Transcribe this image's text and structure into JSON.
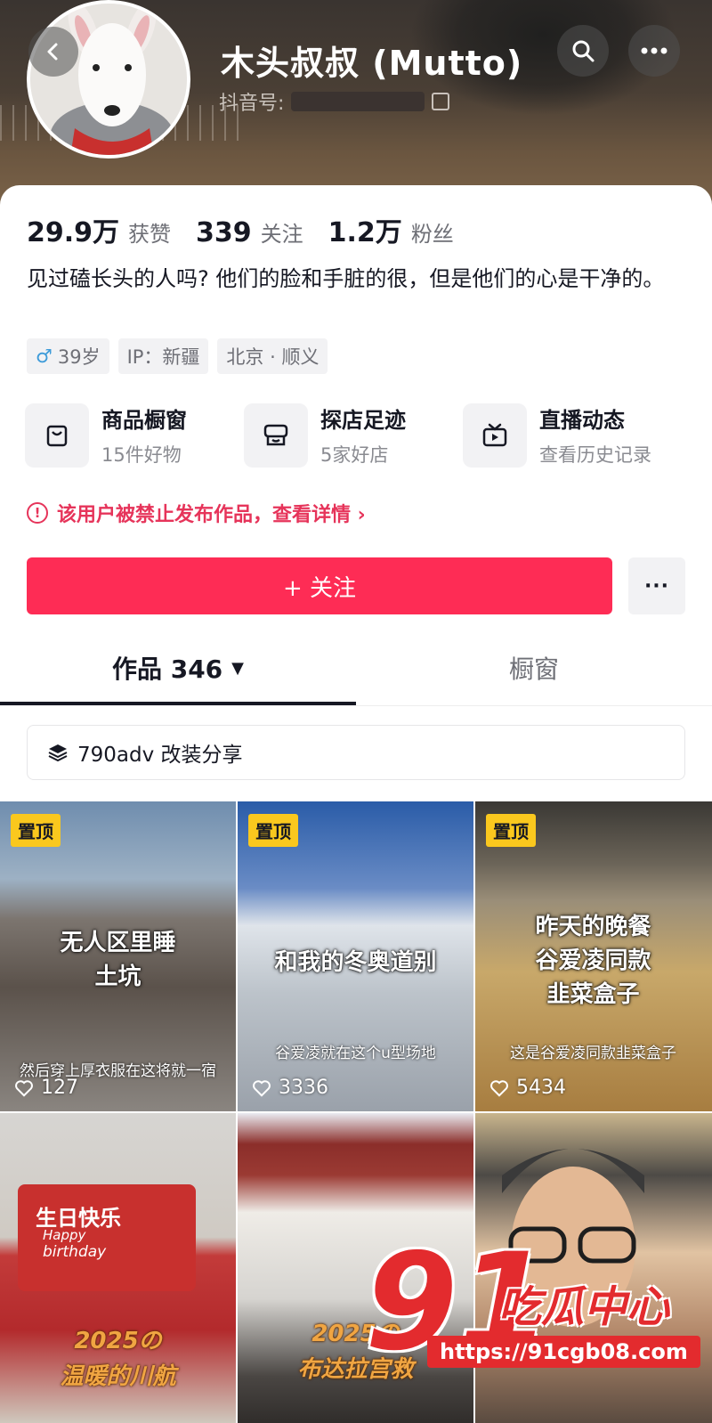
{
  "header": {
    "name": "木头叔叔 (Mutto)",
    "douyin_id_label": "抖音号:",
    "back_icon": "chevron-left-icon",
    "search_icon": "search-icon",
    "more_icon": "ellipsis-icon"
  },
  "stats": [
    {
      "value": "29.9万",
      "label": "获赞"
    },
    {
      "value": "339",
      "label": "关注"
    },
    {
      "value": "1.2万",
      "label": "粉丝"
    }
  ],
  "bio": "见过磕长头的人吗? 他们的脸和手脏的很，但是他们的心是干净的。",
  "tags": {
    "gender_symbol": "♂",
    "age": "39岁",
    "ip": "IP：新疆",
    "location": "北京 · 顺义"
  },
  "features": [
    {
      "title": "商品橱窗",
      "sub": "15件好物",
      "icon": "shopping-bag-icon"
    },
    {
      "title": "探店足迹",
      "sub": "5家好店",
      "icon": "store-icon"
    },
    {
      "title": "直播动态",
      "sub": "查看历史记录",
      "icon": "tv-icon"
    }
  ],
  "banned_notice": "该用户被禁止发布作品，查看详情 ›",
  "follow_button": "+ 关注",
  "follow_more": "···",
  "tabs": {
    "works": "作品 346",
    "shop": "橱窗"
  },
  "collection": "790adv 改装分享",
  "videos": [
    {
      "pinned": "置顶",
      "overlay": "无人区里睡\n土坑",
      "caption": "然后穿上厚衣服在这将就一宿",
      "likes": "127"
    },
    {
      "pinned": "置顶",
      "overlay": "和我的冬奥道别",
      "caption": "谷爱凌就在这个u型场地",
      "likes": "3336"
    },
    {
      "pinned": "置顶",
      "overlay": "昨天的晚餐\n谷爱凌同款\n韭菜盒子",
      "caption": "这是谷爱凌同款韭菜盒子",
      "likes": "5434"
    },
    {
      "bday_title": "生日快乐",
      "bday_happy": "Happy",
      "bday_birthday": "birthday",
      "overlay": "2025の\n温暖的川航"
    },
    {
      "overlay": "2025の\n布达拉宫救"
    },
    {}
  ],
  "watermark": {
    "big": "91",
    "text": "吃瓜中心",
    "url": "https://91cgb08.com"
  },
  "colors": {
    "accent": "#fe2c55",
    "warning": "#e6345a",
    "pin": "#fac81e"
  }
}
